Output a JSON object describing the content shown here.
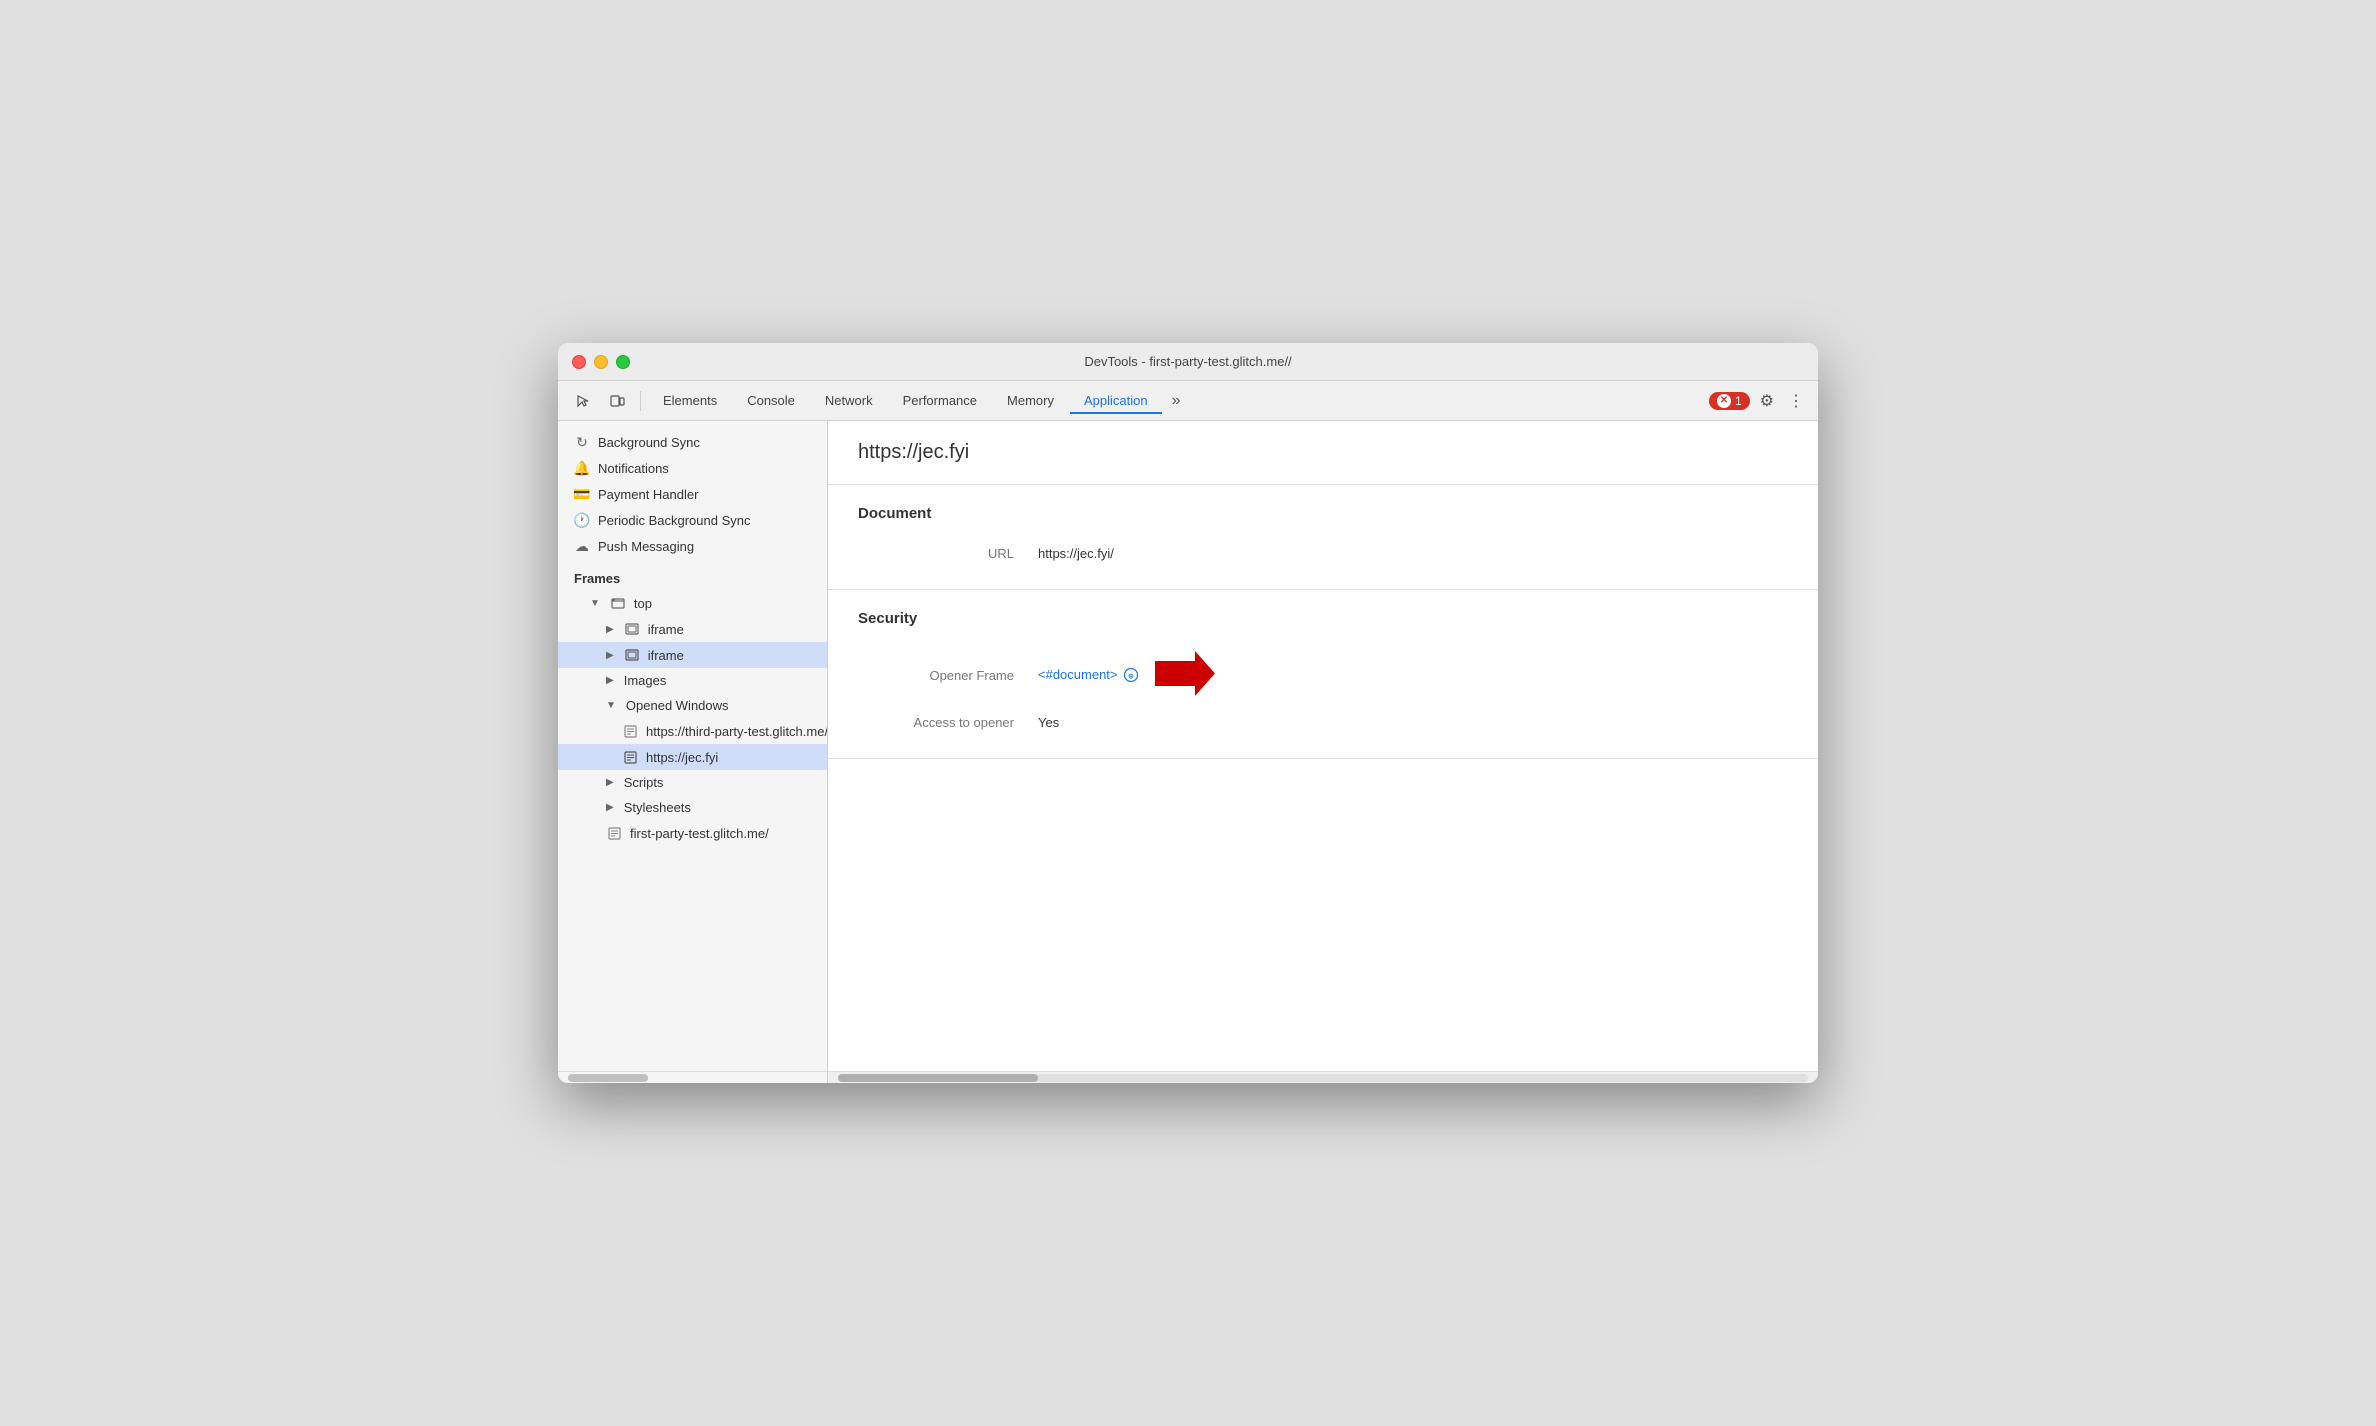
{
  "window": {
    "title": "DevTools - first-party-test.glitch.me//"
  },
  "toolbar": {
    "tabs": [
      "Elements",
      "Console",
      "Network",
      "Performance",
      "Memory",
      "Application"
    ],
    "active_tab": "Application",
    "more_label": "»",
    "error_count": "1",
    "gear_label": "⚙",
    "dots_label": "⋮"
  },
  "sidebar": {
    "items": [
      {
        "label": "Background Sync",
        "icon": "sync",
        "indent": 0
      },
      {
        "label": "Notifications",
        "icon": "bell",
        "indent": 0
      },
      {
        "label": "Payment Handler",
        "icon": "card",
        "indent": 0
      },
      {
        "label": "Periodic Background Sync",
        "icon": "clock",
        "indent": 0
      },
      {
        "label": "Push Messaging",
        "icon": "cloud",
        "indent": 0
      }
    ],
    "frames_header": "Frames",
    "frames_tree": [
      {
        "label": "top",
        "indent": 1,
        "expanded": true,
        "has_expand": true,
        "is_folder": true
      },
      {
        "label": "iframe",
        "indent": 2,
        "has_expand": true,
        "is_folder": true
      },
      {
        "label": "iframe",
        "indent": 2,
        "has_expand": true,
        "is_folder": true,
        "selected": true
      },
      {
        "label": "Images",
        "indent": 2,
        "has_expand": true,
        "is_folder": false
      },
      {
        "label": "Opened Windows",
        "indent": 2,
        "expanded": true,
        "has_expand": true,
        "is_folder": false
      },
      {
        "label": "https://third-party-test.glitch.me/p...",
        "indent": 3,
        "is_folder": false,
        "is_file": true
      },
      {
        "label": "https://jec.fyi",
        "indent": 3,
        "is_folder": false,
        "is_file": true,
        "selected": true
      },
      {
        "label": "Scripts",
        "indent": 2,
        "has_expand": true,
        "is_folder": false
      },
      {
        "label": "Stylesheets",
        "indent": 2,
        "has_expand": true,
        "is_folder": false
      },
      {
        "label": "first-party-test.glitch.me/",
        "indent": 2,
        "is_folder": false,
        "is_file": true
      }
    ]
  },
  "content": {
    "url": "https://jec.fyi",
    "document_section": "Document",
    "url_label": "URL",
    "url_value": "https://jec.fyi/",
    "security_section": "Security",
    "opener_frame_label": "Opener Frame",
    "opener_frame_value": "<#document>",
    "opener_frame_icon": "⓪",
    "access_opener_label": "Access to opener",
    "access_opener_value": "Yes"
  }
}
